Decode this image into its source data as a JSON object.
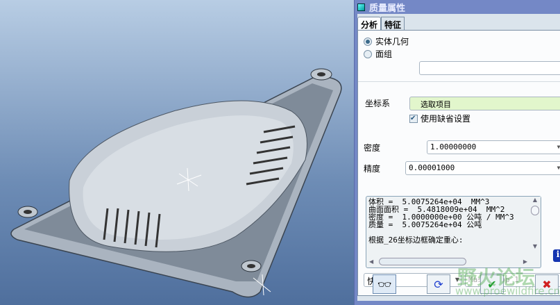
{
  "dialog": {
    "title": "质量属性",
    "tabs": [
      "分析",
      "特征"
    ],
    "geometry_options": [
      "实体几何",
      "面组"
    ],
    "csys_label": "坐标系",
    "csys_value": "选取项目",
    "use_default_label": "使用缺省设置",
    "density_label": "密度",
    "density_value": "1.00000000",
    "accuracy_label": "精度",
    "accuracy_value": "0.00001000",
    "results": [
      "体积 =  5.0075264e+04  MM^3",
      "曲面面积 =  5.4818009e+04  MM^2",
      "密度 =  1.0000000e+00 公吨 / MM^3",
      "质量 =  5.0075264e+04 公吨",
      "",
      "根据_26坐标边框确定重心:"
    ],
    "mode_value": "快速",
    "name_value": "Mass_Prop_1"
  },
  "watermark": {
    "text": "野火论坛",
    "url": "www.proewildfire.cn"
  }
}
